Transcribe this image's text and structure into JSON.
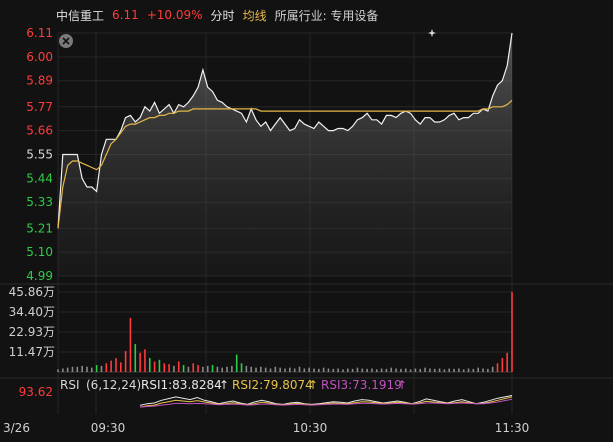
{
  "header": {
    "name": "中信重工",
    "price": "6.11",
    "change": "+10.09%",
    "mode": "分时",
    "avg_label": "均线",
    "industry": "所属行业: 专用设备"
  },
  "colors": {
    "up": "#ff3b3b",
    "down": "#2ecc4a",
    "neutral": "#d8d8d8",
    "avg": "#e6b84a",
    "rsi1": "#e8e8e8",
    "rsi2": "#e6c34a",
    "rsi3": "#c052c0",
    "grid": "#262626"
  },
  "chart_data": [
    {
      "type": "line",
      "title": "",
      "y_ticks": [
        "6.11",
        "6.00",
        "5.89",
        "5.77",
        "5.66",
        "5.55",
        "5.44",
        "5.33",
        "5.21",
        "5.10",
        "4.99"
      ],
      "ylim": [
        4.99,
        6.11
      ],
      "prev_close": 5.55,
      "x_ticks": [
        "3/26",
        "09:30",
        "10:30",
        "11:30"
      ],
      "series": [
        {
          "name": "price",
          "values": [
            5.21,
            5.55,
            5.55,
            5.55,
            5.55,
            5.44,
            5.4,
            5.4,
            5.38,
            5.55,
            5.62,
            5.62,
            5.62,
            5.66,
            5.72,
            5.73,
            5.7,
            5.72,
            5.77,
            5.75,
            5.79,
            5.74,
            5.76,
            5.78,
            5.74,
            5.78,
            5.77,
            5.79,
            5.82,
            5.86,
            5.94,
            5.86,
            5.84,
            5.8,
            5.79,
            5.77,
            5.76,
            5.75,
            5.74,
            5.7,
            5.76,
            5.71,
            5.68,
            5.7,
            5.66,
            5.69,
            5.72,
            5.69,
            5.66,
            5.67,
            5.71,
            5.69,
            5.68,
            5.67,
            5.7,
            5.68,
            5.66,
            5.66,
            5.67,
            5.67,
            5.66,
            5.68,
            5.71,
            5.72,
            5.74,
            5.71,
            5.71,
            5.69,
            5.73,
            5.73,
            5.72,
            5.74,
            5.75,
            5.74,
            5.71,
            5.69,
            5.72,
            5.72,
            5.7,
            5.7,
            5.71,
            5.73,
            5.74,
            5.71,
            5.72,
            5.72,
            5.74,
            5.74,
            5.76,
            5.75,
            5.82,
            5.87,
            5.89,
            5.96,
            6.11
          ]
        },
        {
          "name": "average",
          "values": [
            5.21,
            5.4,
            5.5,
            5.52,
            5.52,
            5.51,
            5.5,
            5.49,
            5.48,
            5.5,
            5.55,
            5.6,
            5.62,
            5.65,
            5.68,
            5.69,
            5.69,
            5.7,
            5.71,
            5.72,
            5.72,
            5.73,
            5.73,
            5.74,
            5.74,
            5.75,
            5.75,
            5.75,
            5.76,
            5.76,
            5.76,
            5.76,
            5.76,
            5.76,
            5.76,
            5.76,
            5.76,
            5.76,
            5.76,
            5.76,
            5.76,
            5.76,
            5.75,
            5.75,
            5.75,
            5.75,
            5.75,
            5.75,
            5.75,
            5.75,
            5.75,
            5.75,
            5.75,
            5.75,
            5.75,
            5.75,
            5.75,
            5.75,
            5.75,
            5.75,
            5.75,
            5.75,
            5.75,
            5.75,
            5.75,
            5.75,
            5.75,
            5.75,
            5.75,
            5.75,
            5.75,
            5.75,
            5.75,
            5.75,
            5.75,
            5.75,
            5.75,
            5.75,
            5.75,
            5.75,
            5.75,
            5.75,
            5.75,
            5.75,
            5.75,
            5.75,
            5.75,
            5.75,
            5.76,
            5.76,
            5.77,
            5.77,
            5.77,
            5.78,
            5.8
          ]
        }
      ]
    },
    {
      "type": "bar",
      "title": "",
      "y_ticks": [
        "45.86万",
        "34.40万",
        "22.93万",
        "11.47万"
      ],
      "ylim": [
        0,
        45.86
      ],
      "unit": "万",
      "series": [
        {
          "name": "volume",
          "values": [
            1.5,
            2.0,
            2.5,
            3.0,
            3.0,
            3.5,
            3.0,
            2.5,
            4.0,
            3.5,
            5.0,
            6.5,
            8.0,
            5.5,
            12.0,
            31.0,
            16.0,
            11.0,
            13.0,
            8.0,
            6.0,
            7.0,
            5.0,
            4.5,
            3.5,
            6.0,
            4.0,
            3.0,
            5.0,
            4.0,
            3.0,
            3.5,
            4.0,
            3.0,
            2.5,
            3.0,
            3.5,
            10.0,
            5.0,
            3.5,
            3.0,
            2.5,
            3.0,
            2.5,
            2.0,
            3.0,
            2.5,
            2.0,
            2.5,
            2.0,
            3.0,
            2.0,
            2.5,
            2.0,
            1.8,
            2.5,
            2.0,
            1.8,
            2.0,
            1.5,
            2.0,
            1.8,
            2.5,
            2.0,
            1.8,
            2.0,
            1.5,
            2.0,
            1.8,
            2.5,
            2.0,
            1.8,
            2.0,
            1.5,
            2.0,
            1.8,
            2.5,
            2.0,
            1.8,
            2.0,
            1.5,
            2.0,
            1.8,
            2.0,
            1.5,
            2.0,
            1.8,
            2.5,
            2.0,
            1.8,
            3.0,
            5.0,
            8.0,
            11.0,
            46.0
          ]
        }
      ]
    },
    {
      "type": "line",
      "title": "",
      "indicator": "RSI (6,12,24)",
      "legend": [
        "RSI1:83.8284",
        "RSI2:79.8074",
        "RSI3:73.1919"
      ],
      "y_ticks": [
        "93.62"
      ],
      "ylim": [
        30,
        100
      ],
      "series": [
        {
          "name": "RSI1",
          "values": [
            55,
            60,
            62,
            70,
            75,
            80,
            76,
            72,
            78,
            70,
            66,
            60,
            64,
            68,
            62,
            58,
            65,
            70,
            66,
            60,
            58,
            62,
            64,
            60,
            58,
            60,
            63,
            66,
            64,
            62,
            68,
            72,
            70,
            66,
            62,
            65,
            68,
            64,
            60,
            66,
            74,
            70,
            66,
            62,
            68,
            72,
            66,
            60,
            64,
            70,
            76,
            80,
            84
          ]
        },
        {
          "name": "RSI2",
          "values": [
            50,
            54,
            56,
            62,
            66,
            70,
            68,
            66,
            69,
            65,
            62,
            58,
            60,
            63,
            60,
            57,
            60,
            64,
            62,
            58,
            57,
            59,
            61,
            59,
            57,
            58,
            60,
            62,
            61,
            60,
            63,
            66,
            65,
            63,
            61,
            62,
            64,
            62,
            60,
            62,
            67,
            65,
            63,
            61,
            63,
            66,
            63,
            60,
            61,
            65,
            70,
            75,
            80
          ]
        },
        {
          "name": "RSI3",
          "values": [
            50,
            52,
            53,
            56,
            58,
            61,
            61,
            60,
            61,
            60,
            59,
            57,
            58,
            59,
            58,
            56,
            57,
            59,
            59,
            57,
            56,
            57,
            58,
            57,
            56,
            57,
            58,
            59,
            59,
            58,
            60,
            61,
            61,
            60,
            59,
            60,
            61,
            60,
            59,
            60,
            62,
            62,
            61,
            60,
            61,
            62,
            61,
            60,
            60,
            62,
            65,
            69,
            73
          ]
        }
      ]
    }
  ],
  "rsi_header": {
    "name": "RSI",
    "params": "(6,12,24)",
    "rsi1": "RSI1:83.8284",
    "rsi2": "RSI2:79.8074",
    "rsi3": "RSI3:73.1919",
    "arrow": "↑"
  },
  "icons": {
    "close": "close-icon",
    "star": "star-marker-icon"
  }
}
